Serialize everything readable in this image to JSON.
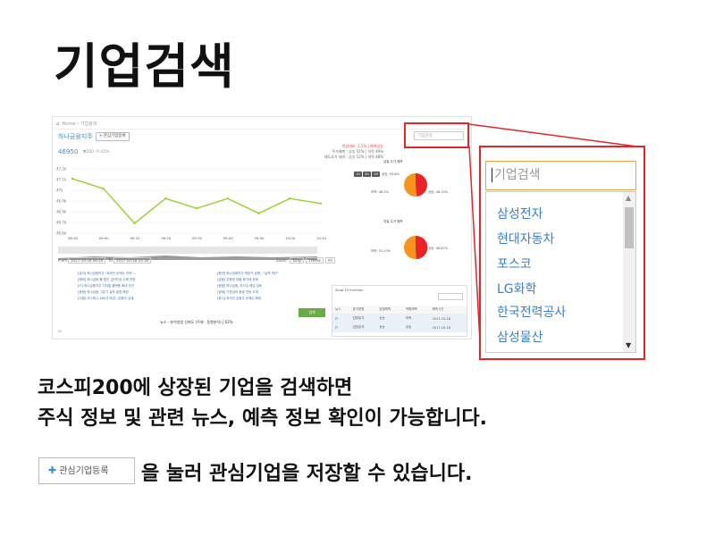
{
  "slide": {
    "title": "기업검색",
    "description_line1": "코스피200에 상장된 기업을 검색하면",
    "description_line2": "주식 정보 및 관련 뉴스, 예측 정보 확인이 가능합니다.",
    "description_line3": "을 눌러 관심기업을 저장할 수 있습니다.",
    "fav_button_label": "관심기업등록"
  },
  "screenshot": {
    "breadcrumb_home": "Home",
    "breadcrumb_current": "기업검색",
    "stock_name": "하나금융지주",
    "fav_button_label": "관심기업등록",
    "price": "46950",
    "price_change": "▼200  -0.42%",
    "search_placeholder": "기업검색",
    "legend_line1": "전일대비 -1.5% | 예측상승",
    "legend_line2": "주가예측 : 상승 51% | 하락 49%",
    "legend_line3": "매도호가 대비 : 상승 52% | 하락 48%",
    "zoom_buttons": [
      "1D",
      "5D",
      "1M"
    ],
    "y_ticks": [
      "47.2k",
      "47.1k",
      "47k",
      "46.9k",
      "46.8k",
      "46.7k",
      "46.6k"
    ],
    "x_ticks": [
      "08:30",
      "09:00",
      "09:10",
      "09:20",
      "09:30",
      "09:40",
      "09:50",
      "10:00",
      "10:10"
    ],
    "range_from": "2017-10-18 08:30",
    "range_to": "2017-10-18 10:18",
    "zoom_label": "Zoom",
    "zoom_options": [
      "1Day",
      "1Week",
      "All"
    ],
    "pie1_title": "금일 주가 예측",
    "pie1_labels": [
      "상승: 53.8%",
      "하락: 46.2%",
      "하락: 46.30%",
      "상승: 46.10%"
    ],
    "pie2_title": "익일 주가 예측",
    "pie2_labels": [
      "하락: 51.13%",
      "상승: 48.87%"
    ],
    "news_left": [
      "[금리] 하나금융지주 \"외국인 순매수 지속\"...",
      "[해외] 하나금융 美 법인 금리인상 수혜 전망",
      "[IT] 하나금융지주 디지털 플랫폼 확대 추진",
      "[종합] 하나금융, 3분기 실적 발표 예정",
      "[시황] 코스피 2,480선 마감...금융주 강세"
    ],
    "news_right": [
      "[증권] 하나금융지주 목표가 상향...\"실적 개선\"",
      "[금융] 은행권 대출 증가세 둔화",
      "[종합] 하나금융, 자사주 매입 검토",
      "[경제] 기준금리 동결 전망 우세",
      "[증시] 외국인 금융주 순매수 확대"
    ],
    "green_button_label": "검색",
    "prediction_text": "뉴스 - 분석방법 신뢰도 (주제 · 동향분석) | 62%",
    "table_header": "Show 10 ▾ entries",
    "table_columns": [
      "뉴스",
      "분석방법",
      "감정예측",
      "적합예측",
      "예측시간"
    ],
    "table_rows": [
      [
        "IT",
        "감정분석",
        "상승",
        "하락",
        "2017-10-18"
      ],
      [
        "IT",
        "감정분석",
        "상승",
        "상승",
        "2017-10-18"
      ]
    ]
  },
  "search_callout": {
    "placeholder": "기업검색",
    "results": [
      "삼성전자",
      "현대자동차",
      "포스코",
      "LG화학",
      "한국전력공사",
      "삼성물산"
    ]
  },
  "colors": {
    "accent_red": "#e8232a",
    "link_blue": "#3d7fc8",
    "series_green": "#9acd32",
    "pie_orange": "#f7941d",
    "pie_red": "#e8232a"
  },
  "chart_data": {
    "type": "line",
    "x": [
      "08:30",
      "09:00",
      "09:10",
      "09:20",
      "09:30",
      "09:40",
      "09:50",
      "10:00",
      "10:10"
    ],
    "y": [
      47150,
      47050,
      46700,
      46950,
      46850,
      46950,
      46800,
      46950,
      46900
    ],
    "ylim": [
      46600,
      47250
    ]
  }
}
